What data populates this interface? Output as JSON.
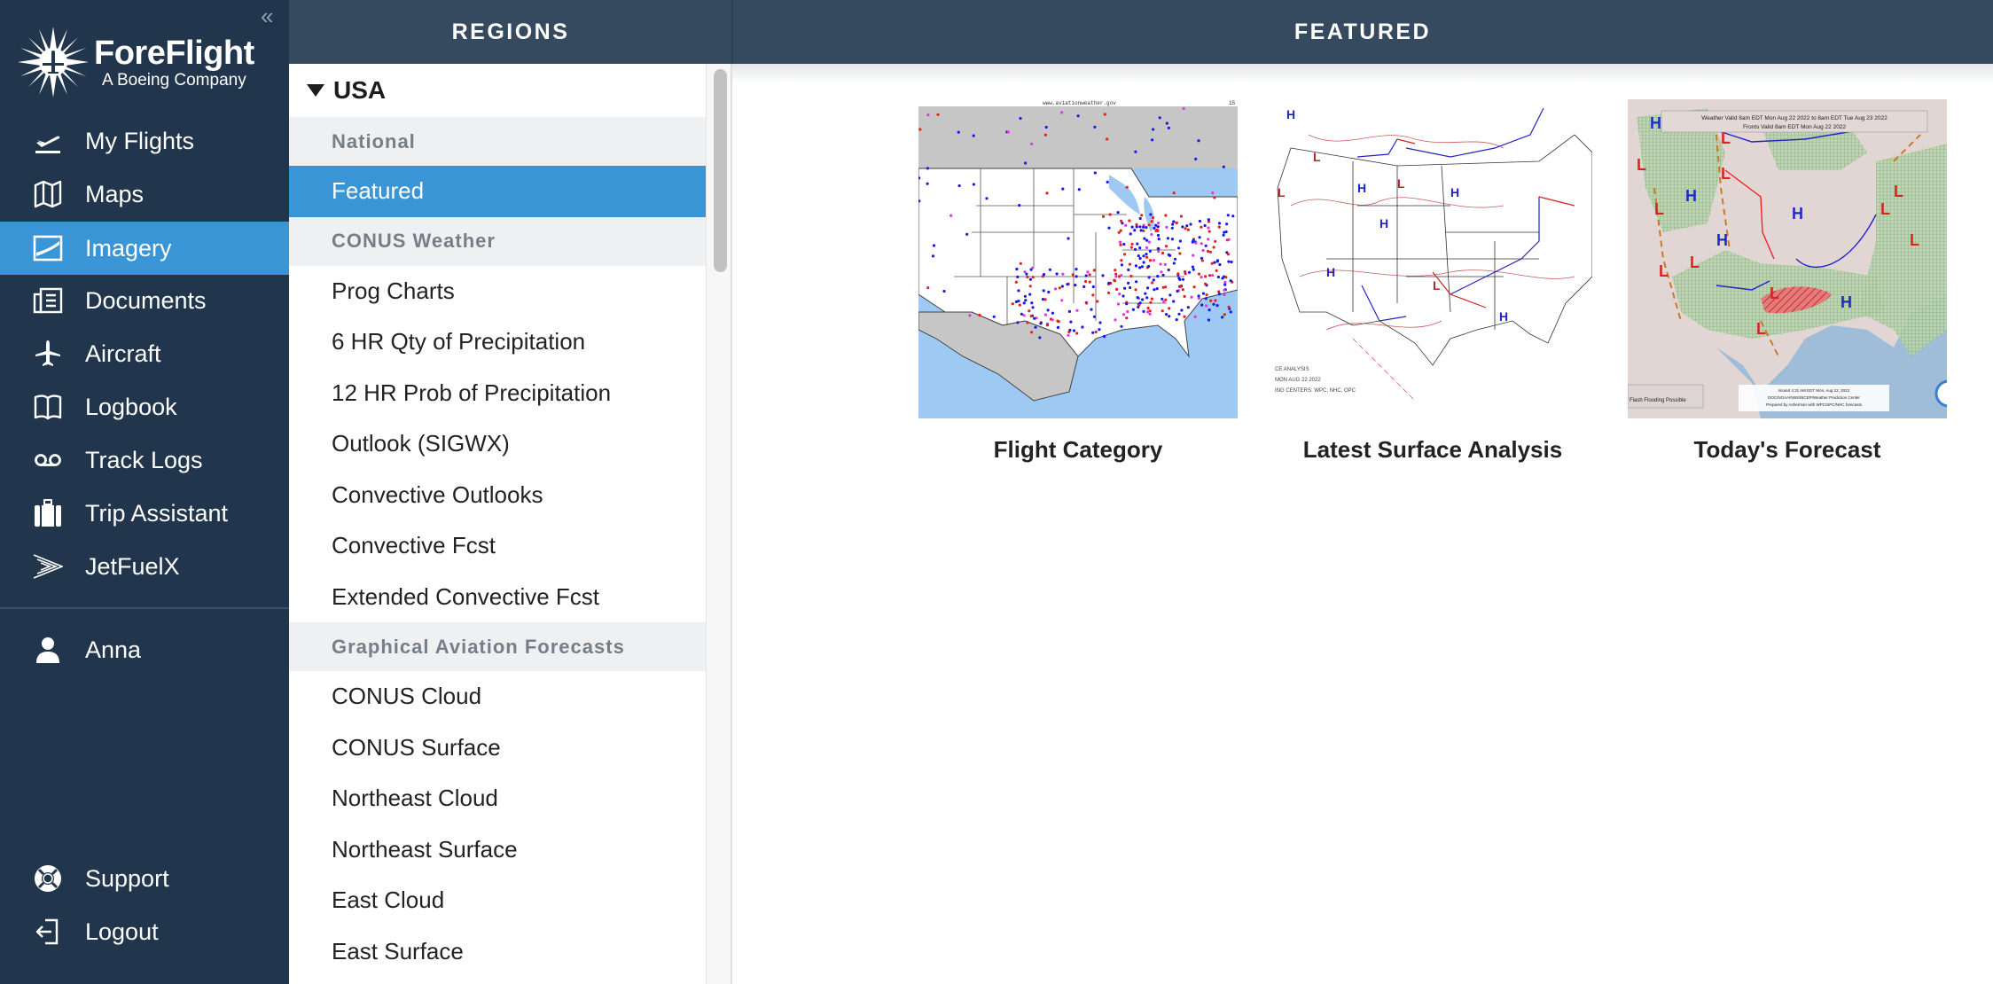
{
  "sidebar": {
    "collapse_icon": "double-chevron-left",
    "logo": {
      "title": "ForeFlight",
      "subtitle": "A Boeing Company"
    },
    "items": [
      {
        "label": "My Flights",
        "icon": "flight-departure-icon"
      },
      {
        "label": "Maps",
        "icon": "map-icon"
      },
      {
        "label": "Imagery",
        "icon": "imagery-icon",
        "active": true
      },
      {
        "label": "Documents",
        "icon": "documents-icon"
      },
      {
        "label": "Aircraft",
        "icon": "airplane-icon"
      },
      {
        "label": "Logbook",
        "icon": "book-icon"
      },
      {
        "label": "Track Logs",
        "icon": "track-logs-icon"
      },
      {
        "label": "Trip Assistant",
        "icon": "suitcase-icon"
      },
      {
        "label": "JetFuelX",
        "icon": "jetfuelx-icon"
      }
    ],
    "user": {
      "label": "Anna",
      "icon": "user-icon"
    },
    "footer": [
      {
        "label": "Support",
        "icon": "lifebuoy-icon"
      },
      {
        "label": "Logout",
        "icon": "logout-icon"
      }
    ]
  },
  "header": {
    "regions_title": "REGIONS",
    "main_title": "FEATURED"
  },
  "regions": {
    "country": "USA",
    "rows": [
      {
        "type": "section",
        "label": "National"
      },
      {
        "type": "item",
        "label": "Featured",
        "selected": true
      },
      {
        "type": "section",
        "label": "CONUS Weather"
      },
      {
        "type": "item",
        "label": "Prog Charts"
      },
      {
        "type": "item",
        "label": "6 HR Qty of Precipitation"
      },
      {
        "type": "item",
        "label": "12 HR Prob of Precipitation"
      },
      {
        "type": "item",
        "label": "Outlook (SIGWX)"
      },
      {
        "type": "item",
        "label": "Convective Outlooks"
      },
      {
        "type": "item",
        "label": "Convective Fcst"
      },
      {
        "type": "item",
        "label": "Extended Convective Fcst"
      },
      {
        "type": "section",
        "label": "Graphical Aviation Forecasts"
      },
      {
        "type": "item",
        "label": "CONUS Cloud"
      },
      {
        "type": "item",
        "label": "CONUS Surface"
      },
      {
        "type": "item",
        "label": "Northeast Cloud"
      },
      {
        "type": "item",
        "label": "Northeast Surface"
      },
      {
        "type": "item",
        "label": "East Cloud"
      },
      {
        "type": "item",
        "label": "East Surface"
      }
    ]
  },
  "featured": [
    {
      "caption": "Flight Category",
      "thumb_header": "www.aviationweather.gov",
      "thumb_corner": "15"
    },
    {
      "caption": "Latest Surface Analysis",
      "thumb_footer": [
        "CE ANALYSIS",
        "MON AUG 22 2022",
        "ING CENTERS: WPC, NHC, OPC"
      ]
    },
    {
      "caption": "Today's Forecast",
      "thumb_banner": [
        "Weather Valid 8am EDT Mon Aug 22 2022 to 8am EDT Tue Aug 23 2022",
        "Fronts Valid 8am EDT Mon Aug 22 2022"
      ],
      "thumb_footer": [
        "Issued 4:31 AM EDT Mon, Aug 22, 2022",
        "DOC/NOAA/NWS/NCEP/Weather Prediction Center",
        "Prepared by Asherman with WPC/SPC/NHC forecasts"
      ],
      "thumb_legend": "Flash Flooding Possible"
    }
  ],
  "colors": {
    "sidebar_bg": "#21354d",
    "header_bg": "#35495f",
    "accent": "#3a95d6",
    "section_bg": "#eff0f2",
    "section_text": "#767e88"
  }
}
